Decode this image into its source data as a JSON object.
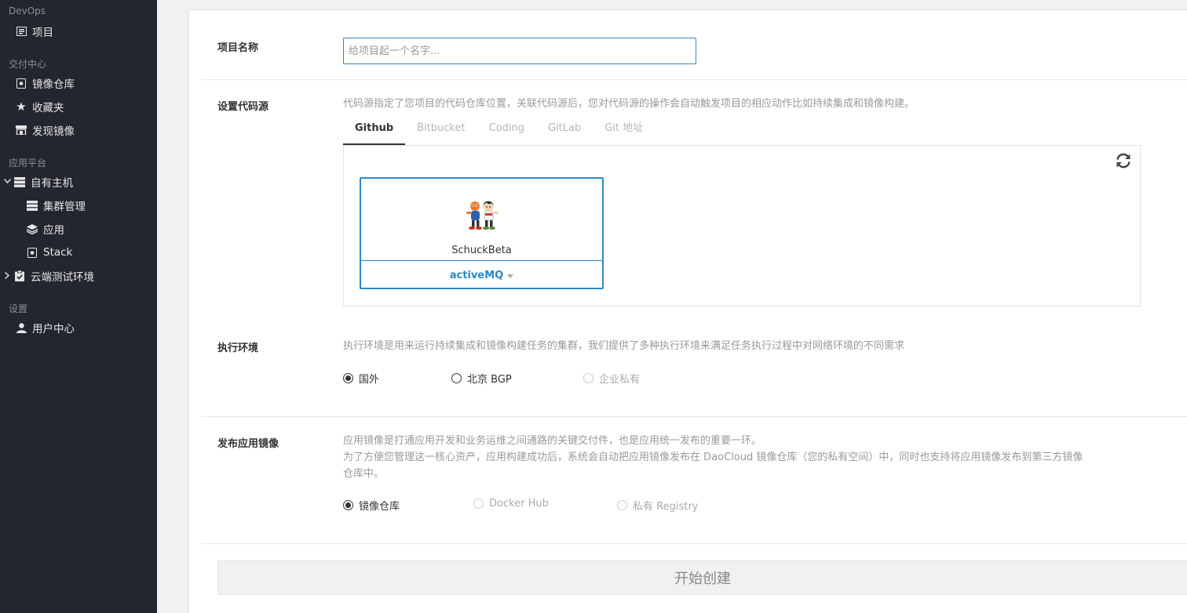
{
  "sidebar": {
    "sections": [
      {
        "title": "DevOps"
      },
      {
        "title": "交付中心"
      },
      {
        "title": "应用平台"
      },
      {
        "title": "设置"
      }
    ],
    "items": {
      "project": "项目",
      "registry": "镜像仓库",
      "favorites": "收藏夹",
      "discover": "发现镜像",
      "own_hosts": "自有主机",
      "cluster": "集群管理",
      "apps": "应用",
      "stack": "Stack",
      "cloud_test": "云端测试环境",
      "user_center": "用户中心"
    }
  },
  "form": {
    "project_name": {
      "label": "项目名称",
      "placeholder": "给项目起一个名字...",
      "value": ""
    },
    "code_source": {
      "label": "设置代码源",
      "description": "代码源指定了您项目的代码仓库位置，关联代码源后，您对代码源的操作会自动触发项目的相应动作比如持续集成和镜像构建。",
      "tabs": [
        "Github",
        "Bitbucket",
        "Coding",
        "GitLab",
        "Git 地址"
      ],
      "active_tab": "Github",
      "org_name": "SchuckBeta",
      "repo_selected": "activeMQ"
    },
    "exec_env": {
      "label": "执行环境",
      "description": "执行环境是用来运行持续集成和镜像构建任务的集群，我们提供了多种执行环境来满足任务执行过程中对网络环境的不同需求",
      "options": [
        "国外",
        "北京 BGP",
        "企业私有"
      ],
      "selected": "国外"
    },
    "publish": {
      "label": "发布应用镜像",
      "description_line1": "应用镜像是打通应用开发和业务运维之间通路的关键交付件，也是应用统一发布的重要一环。",
      "description_line2": "为了方便您管理这一核心资产，应用构建成功后，系统会自动把应用镜像发布在 DaoCloud 镜像仓库（您的私有空间）中，同时也支持将应用镜像发布到第三方镜像",
      "description_line3": "仓库中。",
      "options": [
        "镜像仓库",
        "Docker Hub",
        "私有 Registry"
      ],
      "selected": "镜像仓库"
    },
    "submit_label": "开始创建"
  },
  "colors": {
    "sidebar_bg": "#23262e",
    "accent": "#2b88c6"
  }
}
